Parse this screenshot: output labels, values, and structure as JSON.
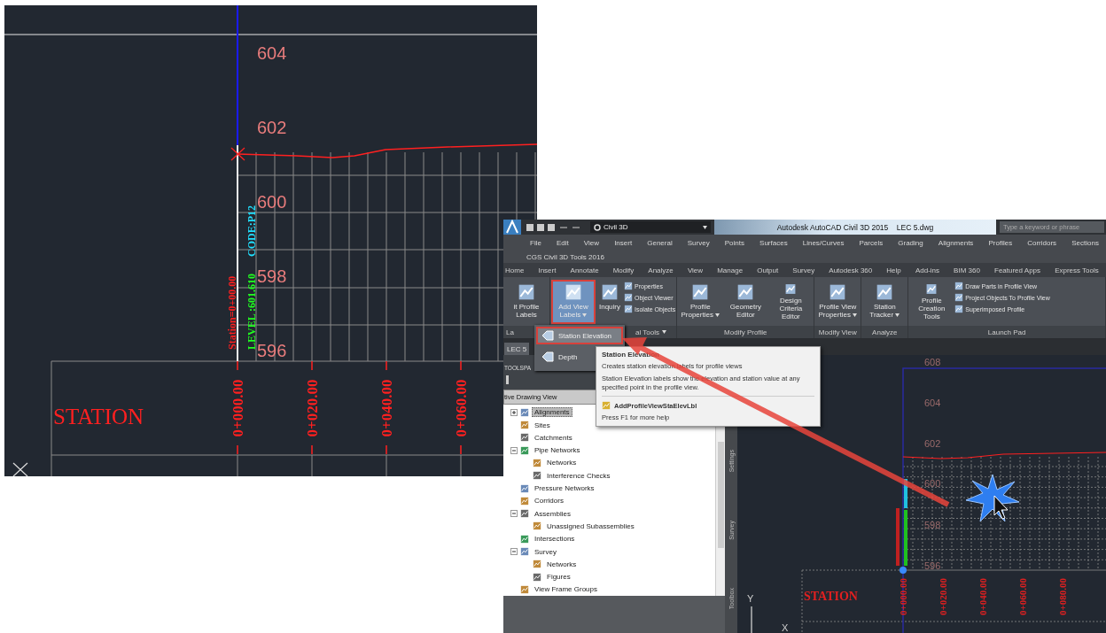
{
  "cad_view": {
    "elevations": [
      "604",
      "602",
      "600",
      "598",
      "596"
    ],
    "row_title": "STATION",
    "stations": [
      "0+000.00",
      "0+020.00",
      "0+040.00",
      "0+060.00"
    ],
    "point_labels": [
      {
        "text": "Station=0+00.00",
        "color": "#ff2020"
      },
      {
        "text": "LEVEL :601.610",
        "color": "#20ff20"
      },
      {
        "text": "CODE:P12",
        "color": "#20e0ff"
      }
    ]
  },
  "app_window": {
    "workspace": "Civil 3D",
    "title": "Autodesk AutoCAD Civil 3D 2015    LEC 5.dwg",
    "search": {
      "placeholder": "Type a keyword or phrase"
    },
    "menu": [
      "File",
      "Edit",
      "View",
      "Insert",
      "General",
      "Survey",
      "Points",
      "Surfaces",
      "Lines/Curves",
      "Parcels",
      "Grading",
      "Alignments",
      "Profiles",
      "Corridors",
      "Sections"
    ],
    "toolbar_row": "CGS Civil 3D Tools 2016",
    "ribbon_tabs": [
      {
        "label": "Home",
        "selected": false
      },
      {
        "label": "Insert",
        "selected": false
      },
      {
        "label": "Annotate",
        "selected": false
      },
      {
        "label": "Modify",
        "selected": false
      },
      {
        "label": "Analyze",
        "selected": false
      },
      {
        "label": "View",
        "selected": false
      },
      {
        "label": "Manage",
        "selected": false
      },
      {
        "label": "Output",
        "selected": false
      },
      {
        "label": "Survey",
        "selected": false
      },
      {
        "label": "Autodesk 360",
        "selected": false
      },
      {
        "label": "Help",
        "selected": false
      },
      {
        "label": "Add-ins",
        "selected": false
      },
      {
        "label": "BIM 360",
        "selected": false
      },
      {
        "label": "Featured Apps",
        "selected": false
      },
      {
        "label": "Express Tools",
        "selected": false
      }
    ],
    "ribbon_panels": [
      {
        "label": "La",
        "buttons": [
          {
            "kind": "large",
            "label": "it Profile Labels",
            "pressed": false,
            "has_menu": false
          }
        ]
      },
      {
        "label": "al Tools",
        "buttons": [
          {
            "kind": "large",
            "label": "Add View Labels",
            "pressed": true,
            "has_menu": true
          },
          {
            "kind": "large",
            "label": "Inquiry",
            "pressed": false,
            "has_menu": false
          },
          {
            "kind": "small",
            "label": "Properties"
          },
          {
            "kind": "small",
            "label": "Object Viewer"
          },
          {
            "kind": "small",
            "label": "Isolate Objects"
          }
        ]
      },
      {
        "label": "Modify Profile",
        "buttons": [
          {
            "kind": "large",
            "label": "Profile Properties",
            "pressed": false,
            "has_menu": true
          },
          {
            "kind": "large",
            "label": "Geometry Editor",
            "pressed": false,
            "has_menu": false
          },
          {
            "kind": "large",
            "label": "Design Criteria Editor",
            "pressed": false,
            "has_menu": false
          }
        ]
      },
      {
        "label": "Modify View",
        "buttons": [
          {
            "kind": "large",
            "label": "Profile View Properties",
            "pressed": false,
            "has_menu": true
          }
        ]
      },
      {
        "label": "Analyze",
        "buttons": [
          {
            "kind": "large",
            "label": "Station Tracker",
            "pressed": false,
            "has_menu": true
          }
        ]
      },
      {
        "label": "Launch Pad",
        "buttons": [
          {
            "kind": "large",
            "label": "Profile Creation Tools",
            "pressed": false,
            "has_menu": false
          },
          {
            "kind": "small",
            "label": "Draw Parts in Profile View"
          },
          {
            "kind": "small",
            "label": "Project Objects To Profile View"
          },
          {
            "kind": "small",
            "label": "Superimposed Profile"
          }
        ]
      }
    ],
    "dropdown": [
      {
        "label": "Station Elevation",
        "selected": true
      },
      {
        "label": "Depth",
        "selected": false
      }
    ],
    "tooltip": {
      "title": "Station Elevation",
      "summary": "Creates station elevation labels for profile views",
      "description": "Station Elevation labels show the elevation and station value at any specified point in the profile view.",
      "command": "AddProfileViewStaElevLbl",
      "help": "Press F1 for more help"
    },
    "document_tab": "LEC 5",
    "toolspace": {
      "title": "TOOLSPA",
      "view_selector": "tive Drawing View",
      "tree": [
        {
          "label": "Alignments",
          "kind": "branch",
          "expanded": false,
          "selected": true
        },
        {
          "label": "Sites",
          "kind": "leaf",
          "selected": false
        },
        {
          "label": "Catchments",
          "kind": "leaf",
          "selected": false
        },
        {
          "label": "Pipe Networks",
          "kind": "branch",
          "expanded": true,
          "selected": false,
          "children": [
            {
              "label": "Networks",
              "kind": "leaf",
              "selected": false
            },
            {
              "label": "Interference Checks",
              "kind": "leaf",
              "selected": false
            }
          ]
        },
        {
          "label": "Pressure Networks",
          "kind": "leaf",
          "selected": false
        },
        {
          "label": "Corridors",
          "kind": "leaf",
          "selected": false
        },
        {
          "label": "Assemblies",
          "kind": "branch",
          "expanded": true,
          "selected": false,
          "children": [
            {
              "label": "Unassigned Subassemblies",
              "kind": "leaf",
              "selected": false
            }
          ]
        },
        {
          "label": "Intersections",
          "kind": "leaf",
          "selected": false
        },
        {
          "label": "Survey",
          "kind": "branch",
          "expanded": true,
          "selected": false,
          "children": [
            {
              "label": "Networks",
              "kind": "leaf",
              "selected": false
            },
            {
              "label": "Figures",
              "kind": "leaf",
              "selected": false
            }
          ]
        },
        {
          "label": "View Frame Groups",
          "kind": "leaf",
          "selected": false
        }
      ],
      "side_tabs": [
        "Settings",
        "Survey",
        "Toolbox"
      ]
    },
    "drawing": {
      "elevations": [
        "608",
        "604",
        "602",
        "600",
        "598",
        "596"
      ],
      "row_title": "STATION",
      "stations": [
        "0+000.00",
        "0+020.00",
        "0+040.00",
        "0+060.00",
        "0+080.00"
      ],
      "axes": [
        "Y",
        "X"
      ]
    }
  }
}
